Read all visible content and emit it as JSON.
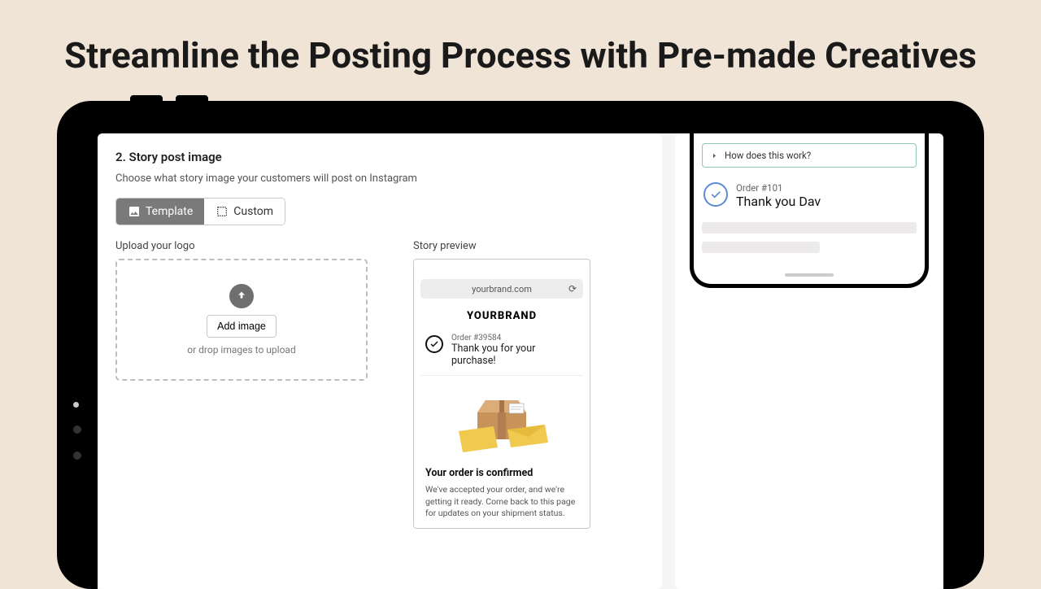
{
  "headline": "Streamline the Posting Process with Pre-made Creatives",
  "step": {
    "title": "2. Story post image",
    "desc": "Choose what story image your customers will post on Instagram",
    "tab_template": "Template",
    "tab_custom": "Custom"
  },
  "upload": {
    "label": "Upload your logo",
    "button": "Add image",
    "hint": "or drop images to upload"
  },
  "preview": {
    "label": "Story preview",
    "url": "yourbrand.com",
    "brand": "YOURBRAND",
    "order_num": "Order #39584",
    "order_thanks": "Thank you for your purchase!",
    "confirm_title": "Your order is confirmed",
    "confirm_body": "We've accepted your order, and we're getting it ready. Come back to this page for updates on your shipment status."
  },
  "phone": {
    "how": "How does this work?",
    "order_num": "Order #101",
    "order_thanks": "Thank you Dav"
  }
}
